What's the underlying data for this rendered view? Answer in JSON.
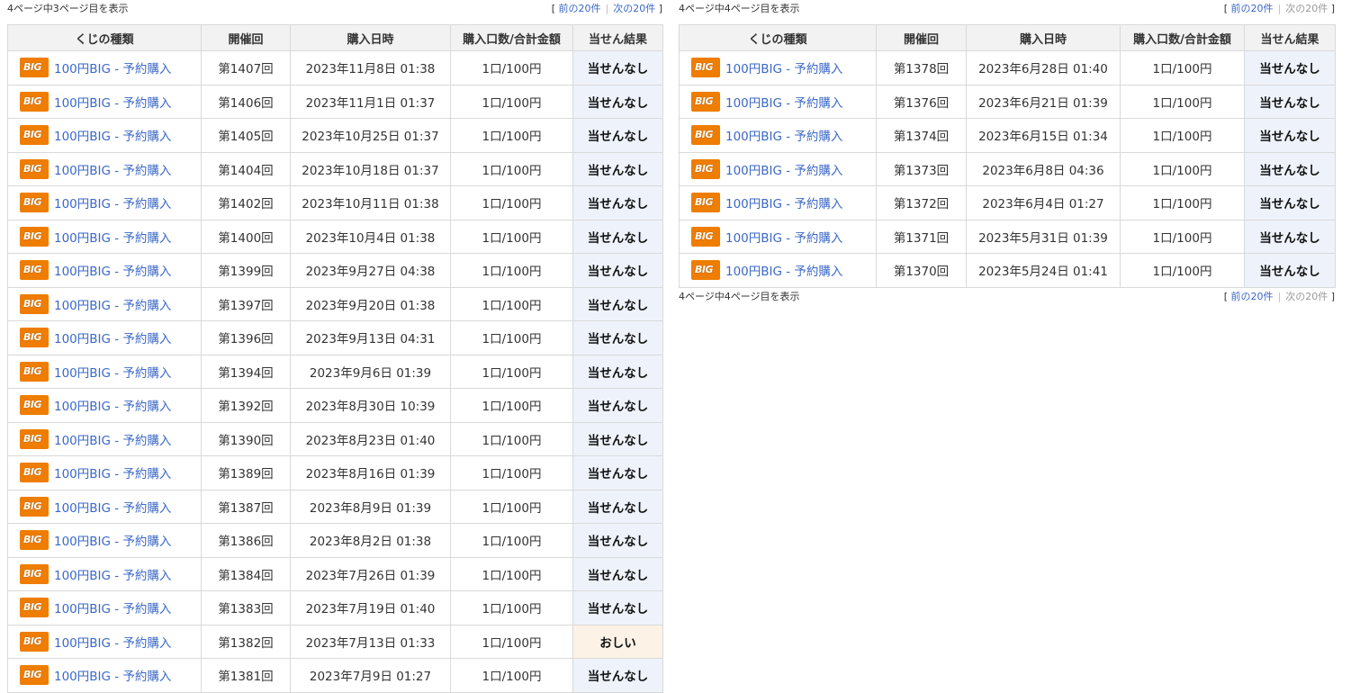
{
  "left": {
    "page_info": "4ページ中3ページ目を表示",
    "nav": {
      "open": "[",
      "prev": "前の20件",
      "sep": "|",
      "next": "次の20件",
      "close": "]"
    },
    "headers": [
      "くじの種類",
      "開催回",
      "購入日時",
      "購入口数/合計金額",
      "当せん結果"
    ],
    "rows": [
      {
        "type": "100円BIG - 予約購入",
        "round": "第1407回",
        "date": "2023年11月8日 01:38",
        "amount": "1口/100円",
        "result": "当せんなし"
      },
      {
        "type": "100円BIG - 予約購入",
        "round": "第1406回",
        "date": "2023年11月1日 01:37",
        "amount": "1口/100円",
        "result": "当せんなし"
      },
      {
        "type": "100円BIG - 予約購入",
        "round": "第1405回",
        "date": "2023年10月25日 01:37",
        "amount": "1口/100円",
        "result": "当せんなし"
      },
      {
        "type": "100円BIG - 予約購入",
        "round": "第1404回",
        "date": "2023年10月18日 01:37",
        "amount": "1口/100円",
        "result": "当せんなし"
      },
      {
        "type": "100円BIG - 予約購入",
        "round": "第1402回",
        "date": "2023年10月11日 01:38",
        "amount": "1口/100円",
        "result": "当せんなし"
      },
      {
        "type": "100円BIG - 予約購入",
        "round": "第1400回",
        "date": "2023年10月4日 01:38",
        "amount": "1口/100円",
        "result": "当せんなし"
      },
      {
        "type": "100円BIG - 予約購入",
        "round": "第1399回",
        "date": "2023年9月27日 04:38",
        "amount": "1口/100円",
        "result": "当せんなし"
      },
      {
        "type": "100円BIG - 予約購入",
        "round": "第1397回",
        "date": "2023年9月20日 01:38",
        "amount": "1口/100円",
        "result": "当せんなし"
      },
      {
        "type": "100円BIG - 予約購入",
        "round": "第1396回",
        "date": "2023年9月13日 04:31",
        "amount": "1口/100円",
        "result": "当せんなし"
      },
      {
        "type": "100円BIG - 予約購入",
        "round": "第1394回",
        "date": "2023年9月6日 01:39",
        "amount": "1口/100円",
        "result": "当せんなし"
      },
      {
        "type": "100円BIG - 予約購入",
        "round": "第1392回",
        "date": "2023年8月30日 10:39",
        "amount": "1口/100円",
        "result": "当せんなし"
      },
      {
        "type": "100円BIG - 予約購入",
        "round": "第1390回",
        "date": "2023年8月23日 01:40",
        "amount": "1口/100円",
        "result": "当せんなし"
      },
      {
        "type": "100円BIG - 予約購入",
        "round": "第1389回",
        "date": "2023年8月16日 01:39",
        "amount": "1口/100円",
        "result": "当せんなし"
      },
      {
        "type": "100円BIG - 予約購入",
        "round": "第1387回",
        "date": "2023年8月9日 01:39",
        "amount": "1口/100円",
        "result": "当せんなし"
      },
      {
        "type": "100円BIG - 予約購入",
        "round": "第1386回",
        "date": "2023年8月2日 01:38",
        "amount": "1口/100円",
        "result": "当せんなし"
      },
      {
        "type": "100円BIG - 予約購入",
        "round": "第1384回",
        "date": "2023年7月26日 01:39",
        "amount": "1口/100円",
        "result": "当せんなし"
      },
      {
        "type": "100円BIG - 予約購入",
        "round": "第1383回",
        "date": "2023年7月19日 01:40",
        "amount": "1口/100円",
        "result": "当せんなし"
      },
      {
        "type": "100円BIG - 予約購入",
        "round": "第1382回",
        "date": "2023年7月13日 01:33",
        "amount": "1口/100円",
        "result": "おしい"
      },
      {
        "type": "100円BIG - 予約購入",
        "round": "第1381回",
        "date": "2023年7月9日 01:27",
        "amount": "1口/100円",
        "result": "当せんなし"
      }
    ]
  },
  "right": {
    "page_info": "4ページ中4ページ目を表示",
    "nav": {
      "open": "[",
      "prev": "前の20件",
      "sep": "|",
      "next": "次の20件",
      "close": "]"
    },
    "headers": [
      "くじの種類",
      "開催回",
      "購入日時",
      "購入口数/合計金額",
      "当せん結果"
    ],
    "rows": [
      {
        "type": "100円BIG - 予約購入",
        "round": "第1378回",
        "date": "2023年6月28日 01:40",
        "amount": "1口/100円",
        "result": "当せんなし"
      },
      {
        "type": "100円BIG - 予約購入",
        "round": "第1376回",
        "date": "2023年6月21日 01:39",
        "amount": "1口/100円",
        "result": "当せんなし"
      },
      {
        "type": "100円BIG - 予約購入",
        "round": "第1374回",
        "date": "2023年6月15日 01:34",
        "amount": "1口/100円",
        "result": "当せんなし"
      },
      {
        "type": "100円BIG - 予約購入",
        "round": "第1373回",
        "date": "2023年6月8日 04:36",
        "amount": "1口/100円",
        "result": "当せんなし"
      },
      {
        "type": "100円BIG - 予約購入",
        "round": "第1372回",
        "date": "2023年6月4日 01:27",
        "amount": "1口/100円",
        "result": "当せんなし"
      },
      {
        "type": "100円BIG - 予約購入",
        "round": "第1371回",
        "date": "2023年5月31日 01:39",
        "amount": "1口/100円",
        "result": "当せんなし"
      },
      {
        "type": "100円BIG - 予約購入",
        "round": "第1370回",
        "date": "2023年5月24日 01:41",
        "amount": "1口/100円",
        "result": "当せんなし"
      }
    ]
  },
  "lottery_icon": {
    "name": "big-logo-icon",
    "text": "BIG",
    "color": "#ee7d00"
  },
  "colors": {
    "link": "#3b68c7",
    "result_bg": "#eef3fb",
    "near_miss_bg": "#fdf2e6",
    "header_bg": "#f2f2f2"
  }
}
